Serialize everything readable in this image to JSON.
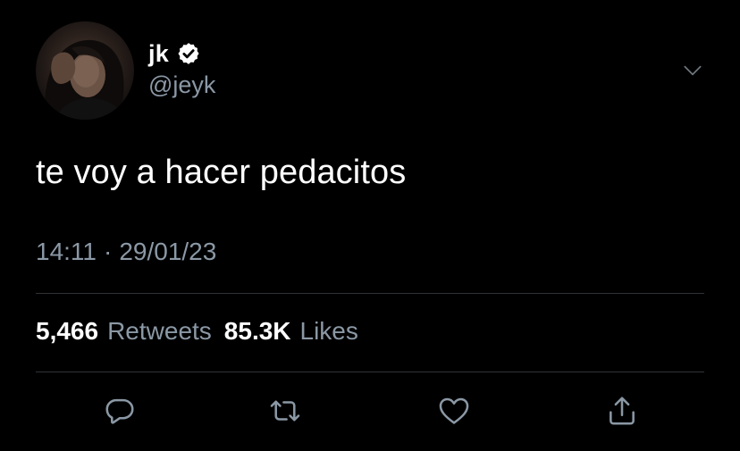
{
  "author": {
    "display_name": "jk",
    "handle": "@jeyk",
    "verified": true,
    "avatar_icon": "avatar-photo"
  },
  "tweet": {
    "text": "te voy a hacer pedacitos",
    "time": "14:11",
    "separator": "·",
    "date": "29/01/23"
  },
  "stats": {
    "retweets_count": "5,466",
    "retweets_label": "Retweets",
    "likes_count": "85.3K",
    "likes_label": "Likes"
  },
  "actions": [
    {
      "icon": "reply-icon"
    },
    {
      "icon": "retweet-icon"
    },
    {
      "icon": "like-icon"
    },
    {
      "icon": "share-icon"
    }
  ],
  "colors": {
    "background": "#000000",
    "text_primary": "#ffffff",
    "text_secondary": "#8b98a5",
    "divider": "#2f3336"
  }
}
